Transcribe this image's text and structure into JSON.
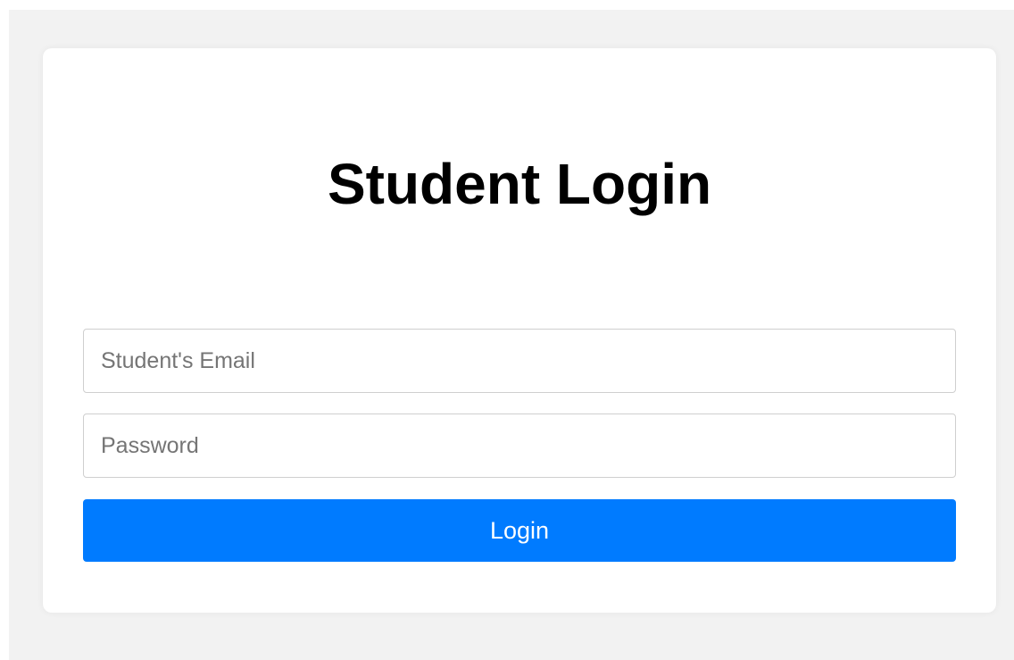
{
  "login": {
    "title": "Student Login",
    "email_placeholder": "Student's Email",
    "email_value": "",
    "password_placeholder": "Password",
    "password_value": "",
    "submit_label": "Login"
  },
  "colors": {
    "page_background": "#f2f2f2",
    "card_background": "#ffffff",
    "accent": "#007bff",
    "title_text": "#000000"
  }
}
